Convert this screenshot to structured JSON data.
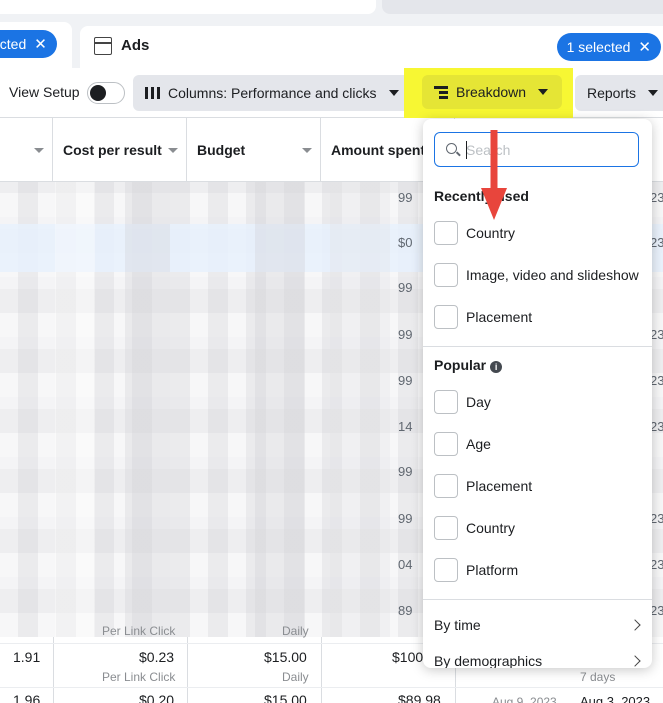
{
  "tabs": {
    "left_pill": {
      "label": "ected",
      "close": "✕"
    },
    "ads_title": "Ads",
    "right_pill": {
      "label": "1 selected",
      "close": "✕"
    }
  },
  "toolbar": {
    "view_setup": "View Setup",
    "columns_label": "Columns: Performance and clicks",
    "breakdown_label": "Breakdown",
    "reports_label": "Reports",
    "highlight_color": "#f7f733"
  },
  "table": {
    "headers": [
      "Cost per result",
      "Budget",
      "Amount spent"
    ],
    "edge_values": [
      "99",
      "$0",
      "99",
      "99",
      "99",
      "14",
      "99",
      "99",
      "04",
      "89"
    ],
    "right_edge": [
      "23",
      "23",
      "3",
      "23",
      "23",
      "23",
      "3",
      "23",
      "23",
      "3",
      "23"
    ],
    "rows": [
      {
        "results": "",
        "cost": "",
        "cost_sub": "Per Link Click",
        "budget": "",
        "budget_sub": "Daily",
        "amount": "",
        "date1": "",
        "date2": ""
      },
      {
        "results": "1.91",
        "cost": "$0.23",
        "cost_sub": "Per Link Click",
        "budget": "$15.00",
        "budget_sub": "Daily",
        "amount": "$100",
        "date1": "",
        "date2": "7 days"
      },
      {
        "results": "1.96",
        "cost": "$0.20",
        "cost_sub": "",
        "budget": "$15.00",
        "budget_sub": "",
        "amount": "$89.98",
        "date1": "Aug 9, 2023",
        "date2": "Aug 3, 2023"
      }
    ]
  },
  "dropdown": {
    "search_placeholder": "Search",
    "recently_used_title": "Recently used",
    "recently_used": [
      "Country",
      "Image, video and slideshow",
      "Placement"
    ],
    "popular_title": "Popular",
    "popular_info": "i",
    "popular": [
      "Day",
      "Age",
      "Placement",
      "Country",
      "Platform"
    ],
    "nav": [
      "By time",
      "By demographics"
    ]
  },
  "annotation": {
    "arrow_color": "#e8453c"
  }
}
